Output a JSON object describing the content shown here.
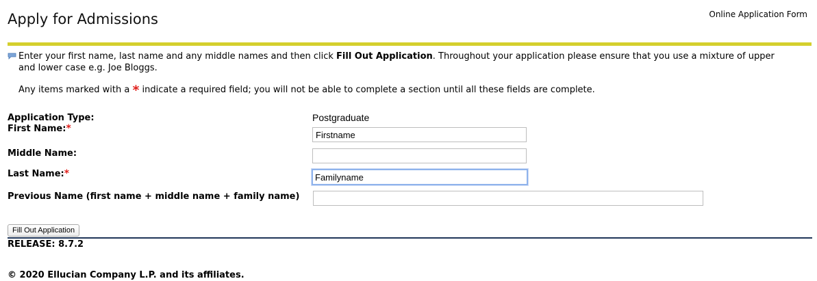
{
  "header": {
    "title": "Apply for Admissions",
    "right_label": "Online Application Form"
  },
  "info": {
    "line1_before": "Enter your first name, last name and any middle names and then click ",
    "line1_bold": "Fill Out Application",
    "line1_after": ". Throughout your application please ensure that you use a mixture of upper",
    "line2": "and lower case e.g. Joe Bloggs.",
    "required_before": "Any items marked with a ",
    "required_star": "*",
    "required_after": " indicate a required field; you will not be able to complete a section until all these fields are complete."
  },
  "form": {
    "application_type": {
      "label": "Application Type:",
      "value": "Postgraduate"
    },
    "first_name": {
      "label": "First Name:",
      "required_mark": "*",
      "value": "Firstname"
    },
    "middle_name": {
      "label": "Middle Name:",
      "value": ""
    },
    "last_name": {
      "label": "Last Name:",
      "required_mark": "*",
      "value": "Familyname"
    },
    "previous_name": {
      "label": "Previous Name (first name + middle name + family name)",
      "value": ""
    },
    "submit_label": "Fill Out Application"
  },
  "footer": {
    "release": "RELEASE: 8.7.2",
    "copyright": "© 2020 Ellucian Company L.P. and its affiliates."
  },
  "colors": {
    "title_rule": "#d4cf2e",
    "release_rule": "#1e3558",
    "required_star": "#e0201c",
    "focus_ring": "#8fb3ec"
  },
  "icons": {
    "info": "speech-bubble-icon"
  }
}
